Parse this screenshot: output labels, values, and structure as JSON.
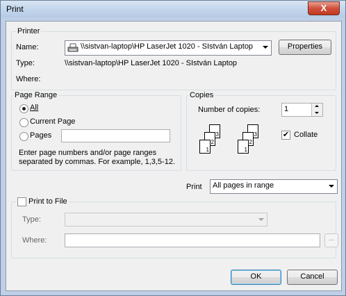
{
  "window": {
    "title": "Print",
    "close_glyph": "X"
  },
  "printer": {
    "legend": "Printer",
    "name_label": "Name:",
    "name_value": "\\\\sistvan-laptop\\HP LaserJet 1020 - SIstván Laptop",
    "properties_label": "Properties",
    "type_label": "Type:",
    "type_value": "\\\\sistvan-laptop\\HP LaserJet 1020 - SIstván Laptop",
    "where_label": "Where:",
    "printer_icon": "printer-icon"
  },
  "page_range": {
    "legend": "Page Range",
    "options": [
      "All",
      "Current Page",
      "Pages"
    ],
    "selected": "All",
    "help_line1": "Enter page numbers and/or page ranges",
    "help_line2": "separated by commas.  For example, 1,3,5-12."
  },
  "copies": {
    "legend": "Copies",
    "number_label": "Number of copies:",
    "number_value": "1",
    "collate_label": "Collate",
    "collate_checked": true,
    "page_numbers": [
      "1",
      "2",
      "3"
    ]
  },
  "print_select": {
    "label": "Print",
    "value": "All pages in range"
  },
  "print_to_file": {
    "legend": "Print to File",
    "checked": false,
    "type_label": "Type:",
    "where_label": "Where:",
    "browse_label": "..."
  },
  "buttons": {
    "ok": "OK",
    "cancel": "Cancel"
  }
}
